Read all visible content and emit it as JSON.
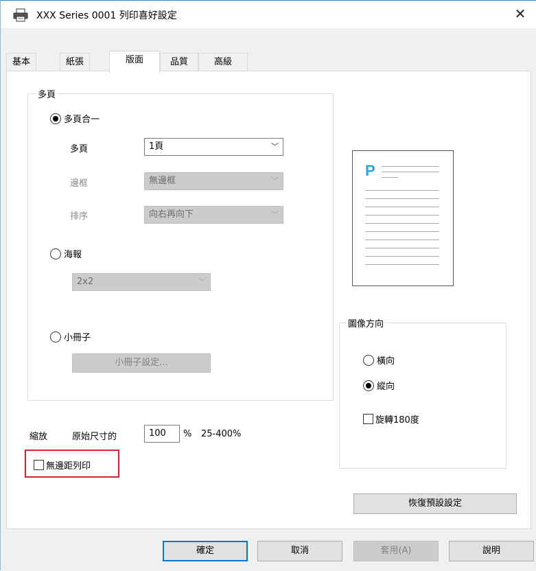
{
  "window": {
    "title": "XXX  Series 0001 列印喜好設定",
    "close_glyph": "✕"
  },
  "tabs": [
    {
      "label": "基本"
    },
    {
      "label": "紙張"
    },
    {
      "label": "版面",
      "active": true
    },
    {
      "label": "品質"
    },
    {
      "label": "高級"
    }
  ],
  "multipage_group": {
    "title": "多頁",
    "nup_radio": "多頁合一",
    "pages_label": "多頁",
    "pages_value": "1頁",
    "border_label": "邊框",
    "border_value": "無邊框",
    "order_label": "排序",
    "order_value": "向右再向下",
    "poster_radio": "海報",
    "poster_value": "2x2",
    "booklet_radio": "小冊子",
    "booklet_settings_button": "小冊子設定..."
  },
  "orientation_group": {
    "title": "圖像方向",
    "landscape": "橫向",
    "portrait": "縱向",
    "rotate180": "旋轉180度",
    "selected": "portrait"
  },
  "scaling": {
    "label": "縮放",
    "sublabel": "原始尺寸的",
    "value": "100",
    "unit": "%",
    "range": "25-400%"
  },
  "borderless_checkbox": "無邊距列印",
  "restore_defaults_button": "恢復預設設定",
  "footer": {
    "ok": "確定",
    "cancel": "取消",
    "apply": "套用(A)",
    "help": "說明"
  },
  "colors": {
    "accent": "#0078d7",
    "highlight": "#e0202a",
    "preview_letter": "#2aa6e6"
  }
}
